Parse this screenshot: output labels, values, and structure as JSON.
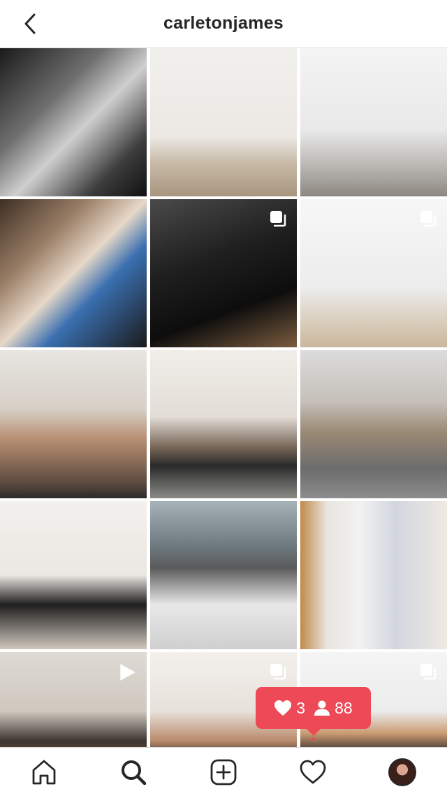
{
  "header": {
    "username": "carletonjames",
    "back_icon": "chevron-left-icon"
  },
  "posts": [
    {
      "type": "photo"
    },
    {
      "type": "photo"
    },
    {
      "type": "photo"
    },
    {
      "type": "photo"
    },
    {
      "type": "carousel",
      "badge_icon": "carousel-icon"
    },
    {
      "type": "carousel",
      "badge_icon": "carousel-icon"
    },
    {
      "type": "photo"
    },
    {
      "type": "photo"
    },
    {
      "type": "photo"
    },
    {
      "type": "photo"
    },
    {
      "type": "photo"
    },
    {
      "type": "photo"
    },
    {
      "type": "video",
      "badge_icon": "video-play-icon"
    },
    {
      "type": "carousel",
      "badge_icon": "carousel-icon"
    },
    {
      "type": "carousel",
      "badge_icon": "carousel-icon"
    }
  ],
  "notification": {
    "likes_count": "3",
    "followers_count": "88",
    "likes_icon": "heart-filled-icon",
    "followers_icon": "person-icon",
    "color": "#ed4956"
  },
  "tabbar": {
    "items": [
      {
        "icon": "home-icon"
      },
      {
        "icon": "search-icon",
        "active": true
      },
      {
        "icon": "add-post-icon"
      },
      {
        "icon": "heart-icon",
        "has_activity_dot": true
      },
      {
        "icon": "profile-avatar"
      }
    ]
  },
  "colors": {
    "text": "#262626",
    "divider": "#dbdbdb",
    "accent": "#ed4956"
  }
}
